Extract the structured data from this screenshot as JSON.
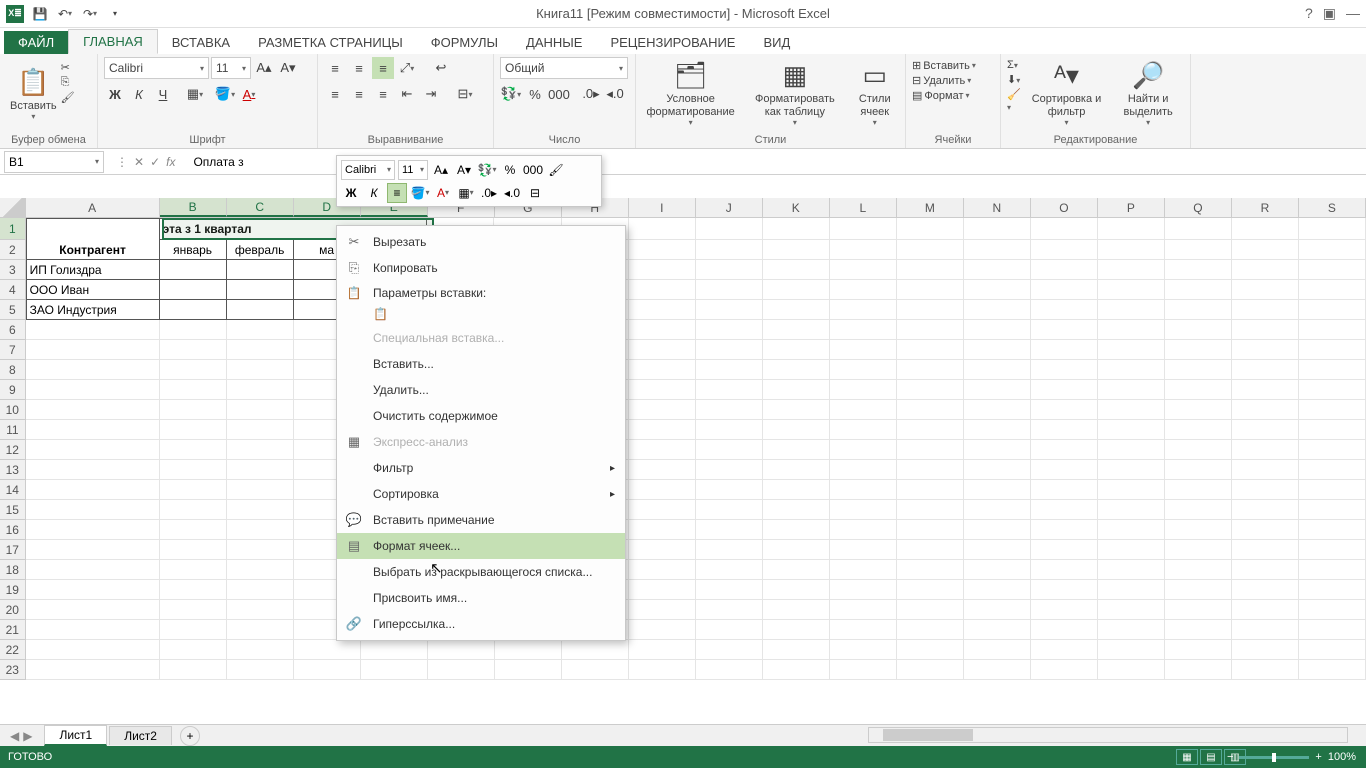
{
  "title": "Книга11  [Режим совместимости] - Microsoft Excel",
  "tabs": {
    "file": "ФАЙЛ",
    "home": "ГЛАВНАЯ",
    "insert": "ВСТАВКА",
    "page_layout": "РАЗМЕТКА СТРАНИЦЫ",
    "formulas": "ФОРМУЛЫ",
    "data": "ДАННЫЕ",
    "review": "РЕЦЕНЗИРОВАНИЕ",
    "view": "ВИД"
  },
  "ribbon": {
    "clipboard": {
      "paste": "Вставить",
      "label": "Буфер обмена"
    },
    "font": {
      "name": "Calibri",
      "size": "11",
      "bold": "Ж",
      "italic": "К",
      "underline": "Ч",
      "label": "Шрифт"
    },
    "alignment": {
      "label": "Выравнивание"
    },
    "number": {
      "format": "Общий",
      "label": "Число"
    },
    "styles": {
      "conditional": "Условное форматирование",
      "as_table": "Форматировать как таблицу",
      "cell_styles": "Стили ячеек",
      "label": "Стили"
    },
    "cells": {
      "insert": "Вставить",
      "delete": "Удалить",
      "format": "Формат",
      "label": "Ячейки"
    },
    "editing": {
      "sort": "Сортировка и фильтр",
      "find": "Найти и выделить",
      "label": "Редактирование"
    }
  },
  "name_box": "B1",
  "formula_text": "Оплата з",
  "mini": {
    "font": "Calibri",
    "size": "11",
    "bold": "Ж",
    "italic": "К"
  },
  "context_menu": {
    "cut": "Вырезать",
    "copy": "Копировать",
    "paste_options": "Параметры вставки:",
    "paste_special": "Специальная вставка...",
    "insert": "Вставить...",
    "delete": "Удалить...",
    "clear": "Очистить содержимое",
    "quick_analysis": "Экспресс-анализ",
    "filter": "Фильтр",
    "sort": "Сортировка",
    "comment": "Вставить примечание",
    "format_cells": "Формат ячеек...",
    "dropdown": "Выбрать из раскрывающегося списка...",
    "define_name": "Присвоить имя...",
    "hyperlink": "Гиперссылка..."
  },
  "data": {
    "header_merged": "эта з 1 квартал",
    "a12": "Контрагент",
    "b2": "январь",
    "c2": "февраль",
    "d2": "ма",
    "a3": "ИП Голиздра",
    "a4": "ООО Иван",
    "a5": "ЗАО Индустрия"
  },
  "columns": [
    "A",
    "B",
    "C",
    "D",
    "E",
    "F",
    "G",
    "H",
    "I",
    "J",
    "K",
    "L",
    "M",
    "N",
    "O",
    "P",
    "Q",
    "R",
    "S"
  ],
  "sheets": {
    "s1": "Лист1",
    "s2": "Лист2"
  },
  "status": "ГОТОВО",
  "zoom": "100%"
}
